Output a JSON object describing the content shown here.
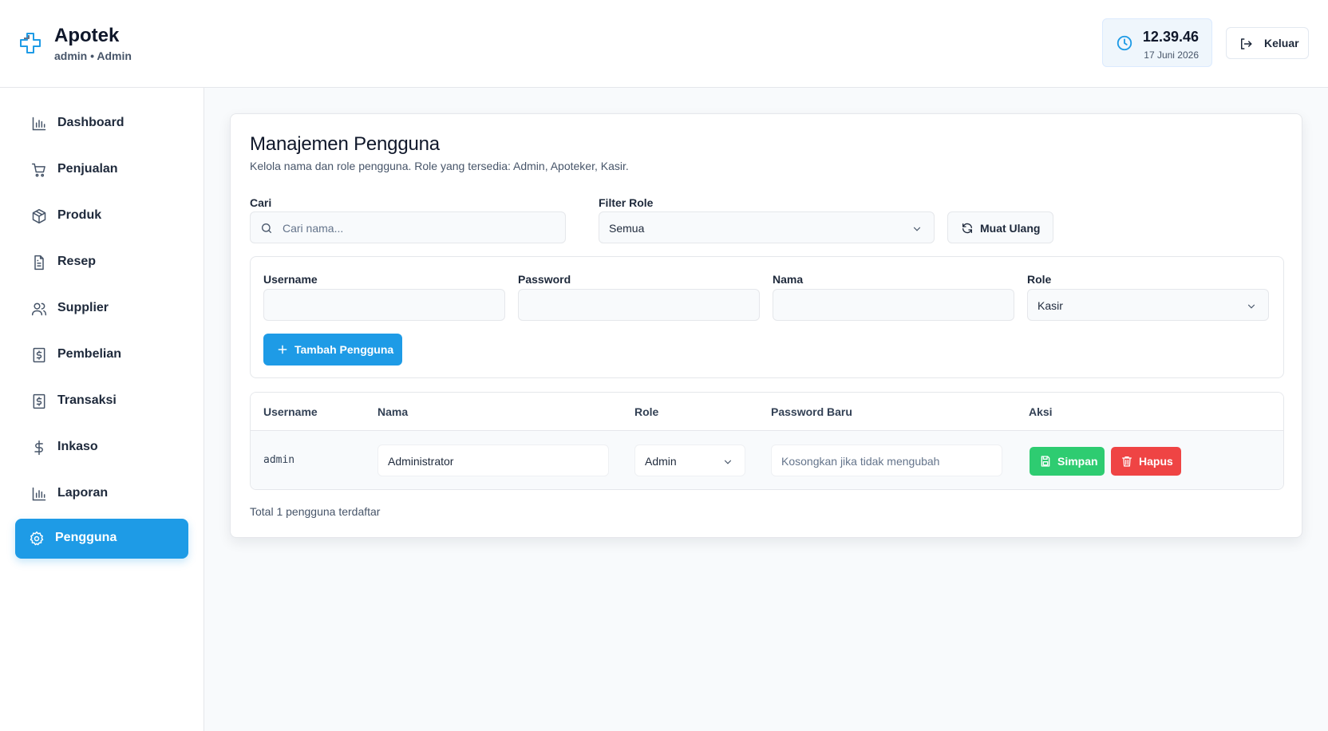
{
  "header": {
    "app_name": "Apotek",
    "user_line": "admin • Admin",
    "clock": {
      "time": "12.39.46",
      "date": "17 Juni 2026"
    },
    "logout_label": "Keluar"
  },
  "sidebar": {
    "items": [
      {
        "label": "Dashboard",
        "icon": "bar-chart-icon"
      },
      {
        "label": "Penjualan",
        "icon": "cart-icon"
      },
      {
        "label": "Produk",
        "icon": "box-icon"
      },
      {
        "label": "Resep",
        "icon": "document-icon"
      },
      {
        "label": "Supplier",
        "icon": "users-icon"
      },
      {
        "label": "Pembelian",
        "icon": "receipt-dollar-icon"
      },
      {
        "label": "Transaksi",
        "icon": "receipt-dollar-icon"
      },
      {
        "label": "Inkaso",
        "icon": "dollar-icon"
      },
      {
        "label": "Laporan",
        "icon": "bar-chart-icon"
      },
      {
        "label": "Pengguna",
        "icon": "gear-icon",
        "active": true
      }
    ]
  },
  "main": {
    "title": "Manajemen Pengguna",
    "description": "Kelola nama dan role pengguna. Role yang tersedia: Admin, Apoteker, Kasir.",
    "search": {
      "label": "Cari",
      "placeholder": "Cari nama..."
    },
    "filter_role": {
      "label": "Filter Role",
      "value": "Semua"
    },
    "reload_label": "Muat Ulang",
    "form": {
      "username_label": "Username",
      "password_label": "Password",
      "nama_label": "Nama",
      "role_label": "Role",
      "role_value": "Kasir",
      "add_label": "Tambah Pengguna"
    },
    "table": {
      "columns": [
        "Username",
        "Nama",
        "Role",
        "Password Baru",
        "Aksi"
      ],
      "rows": [
        {
          "username": "admin",
          "nama": "Administrator",
          "role": "Admin",
          "password_placeholder": "Kosongkan jika tidak mengubah",
          "save_label": "Simpan",
          "delete_label": "Hapus"
        }
      ]
    },
    "total_text": "Total 1 pengguna terdaftar"
  },
  "colors": {
    "accent": "#1e9be6",
    "success": "#2ecc71",
    "danger": "#ef4444"
  }
}
